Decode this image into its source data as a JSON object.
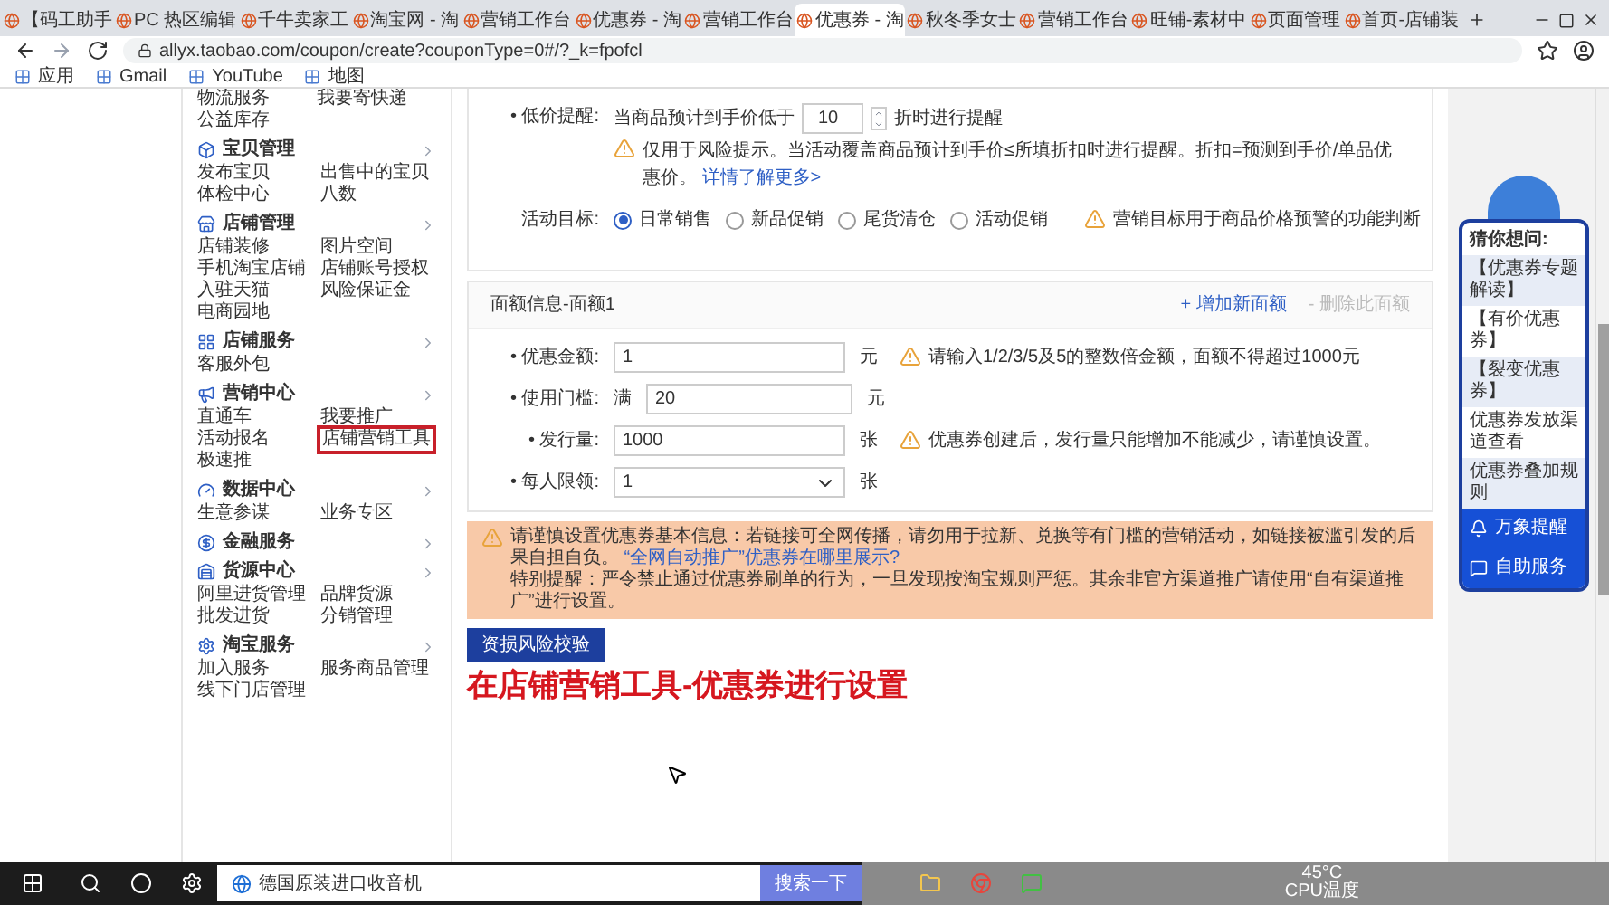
{
  "browser": {
    "tabs": [
      {
        "title": "【码工助手",
        "selected": false
      },
      {
        "title": "PC 热区编辑",
        "selected": false
      },
      {
        "title": "千牛卖家工",
        "selected": false
      },
      {
        "title": "淘宝网 - 淘",
        "selected": false
      },
      {
        "title": "营销工作台",
        "selected": false
      },
      {
        "title": "优惠券 - 淘",
        "selected": false
      },
      {
        "title": "营销工作台",
        "selected": false
      },
      {
        "title": "优惠券 - 淘",
        "selected": true
      },
      {
        "title": "秋冬季女士",
        "selected": false
      },
      {
        "title": "营销工作台",
        "selected": false
      },
      {
        "title": "旺铺-素材中",
        "selected": false
      },
      {
        "title": "页面管理",
        "selected": false
      },
      {
        "title": "首页-店铺装",
        "selected": false
      }
    ],
    "url": "allyx.taobao.com/coupon/create?couponType=0#/?_k=fpofcl",
    "bookmarks": [
      "应用",
      "Gmail",
      "YouTube",
      "地图"
    ]
  },
  "sidebar": {
    "top_rows": [
      [
        "物流服务",
        "我要寄快递"
      ],
      [
        "公益库存"
      ]
    ],
    "groups": [
      {
        "title": "宝贝管理",
        "items": [
          {
            "label": "发布宝贝",
            "highlighted": false
          },
          {
            "label": "出售中的宝贝",
            "highlighted": false
          },
          {
            "label": "体检中心",
            "highlighted": false
          },
          {
            "label": "八数",
            "highlighted": false
          }
        ]
      },
      {
        "title": "店铺管理",
        "items": [
          {
            "label": "店铺装修",
            "highlighted": false
          },
          {
            "label": "图片空间",
            "highlighted": false
          },
          {
            "label": "手机淘宝店铺",
            "highlighted": false
          },
          {
            "label": "店铺账号授权",
            "highlighted": false
          },
          {
            "label": "入驻天猫",
            "highlighted": false
          },
          {
            "label": "风险保证金",
            "highlighted": false
          },
          {
            "label": "电商园地",
            "highlighted": false
          }
        ]
      },
      {
        "title": "店铺服务",
        "items": [
          {
            "label": "客服外包",
            "highlighted": false
          }
        ]
      },
      {
        "title": "营销中心",
        "items": [
          {
            "label": "直通车",
            "highlighted": false
          },
          {
            "label": "我要推广",
            "highlighted": false
          },
          {
            "label": "活动报名",
            "highlighted": false
          },
          {
            "label": "店铺营销工具",
            "highlighted": true
          },
          {
            "label": "极速推",
            "highlighted": false
          }
        ]
      },
      {
        "title": "数据中心",
        "items": [
          {
            "label": "生意参谋",
            "highlighted": false
          },
          {
            "label": "业务专区",
            "highlighted": false
          }
        ]
      },
      {
        "title": "金融服务"
      },
      {
        "title": "货源中心",
        "items": [
          {
            "label": "阿里进货管理",
            "highlighted": false
          },
          {
            "label": "品牌货源",
            "highlighted": false
          },
          {
            "label": "批发进货",
            "highlighted": false
          },
          {
            "label": "分销管理",
            "highlighted": false
          }
        ]
      },
      {
        "title": "淘宝服务",
        "items": [
          {
            "label": "加入服务",
            "highlighted": false
          },
          {
            "label": "服务商品管理",
            "highlighted": false
          },
          {
            "label": "线下门店管理",
            "highlighted": false
          }
        ]
      }
    ]
  },
  "price_alert": {
    "label": "• 低价提醒:",
    "text_before": "当商品预计到手价低于",
    "value": "10",
    "text_after": "折时进行提醒",
    "warning": "仅用于风险提示。当活动覆盖商品预计到手价≤所填折扣时进行提醒。折扣=预测到手价/单品优惠价。",
    "link": "详情了解更多>"
  },
  "goal": {
    "label": "活动目标:",
    "options": [
      {
        "label": "日常销售",
        "selected": true
      },
      {
        "label": "新品促销",
        "selected": false
      },
      {
        "label": "尾货清仓",
        "selected": false
      },
      {
        "label": "活动促销",
        "selected": false
      }
    ],
    "warning": "营销目标用于商品价格预警的功能判断"
  },
  "denomination": {
    "title": "面额信息-面额1",
    "add_link": "+ 增加新面额",
    "delete_link": {
      "label": "- 删除此面额",
      "disabled": true
    },
    "rows": [
      {
        "kind": "input",
        "label": "• 优惠金额:",
        "value": "1",
        "unit": "元",
        "warning": "请输入1/2/3/5及5的整数倍金额，面额不得超过1000元"
      },
      {
        "kind": "input",
        "label": "• 使用门槛:",
        "prefix": "满",
        "value": "20",
        "unit": "元"
      },
      {
        "kind": "input",
        "label": "• 发行量:",
        "value": "1000",
        "unit": "张",
        "warning": "优惠券创建后，发行量只能增加不能减少，请谨慎设置。"
      },
      {
        "kind": "select",
        "label": "• 每人限领:",
        "value": "1",
        "unit": "张"
      }
    ]
  },
  "banner": {
    "line1": "请谨慎设置优惠券基本信息：若链接可全网传播，请勿用于拉新、兑换等有门槛的营销活动，如链接被滥引发的后果自担自负。",
    "link": "“全网自动推广”优惠券在哪里展示?",
    "line2": "特别提醒：严令禁止通过优惠券刷单的行为，一旦发现按淘宝规则严惩。其余非官方渠道推广请使用“自有渠道推广”进行设置。"
  },
  "check_button": "资损风险校验",
  "annotation": "在店铺营销工具-优惠券进行设置",
  "helper": {
    "title": "猜你想问:",
    "questions": [
      "【优惠券专题解读】",
      "【有价优惠券】",
      "【裂变优惠券】",
      "优惠券发放渠道查看",
      "优惠券叠加规则"
    ],
    "actions": [
      "万象提醒",
      "自助服务"
    ]
  },
  "taskbar": {
    "search_value": "德国原装进口收音机",
    "search_button": "搜索一下",
    "temperature": "45°C",
    "temperature_label": "CPU温度"
  }
}
